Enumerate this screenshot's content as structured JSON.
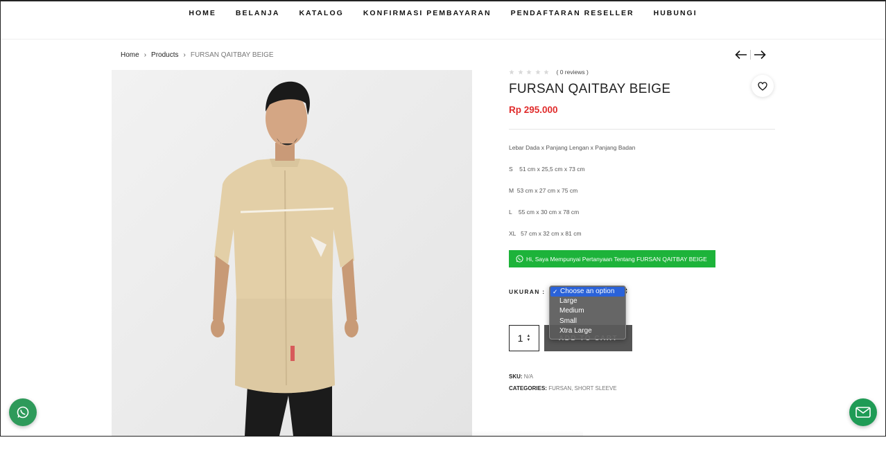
{
  "nav": {
    "items": [
      "HOME",
      "BELANJA",
      "KATALOG",
      "KONFIRMASI PEMBAYARAN",
      "PENDAFTARAN RESELLER",
      "HUBUNGI"
    ]
  },
  "breadcrumb": {
    "home": "Home",
    "products": "Products",
    "current": "FURSAN QAITBAY BEIGE"
  },
  "product": {
    "rating_stars": 0,
    "reviews": "( 0 reviews )",
    "title": "FURSAN QAITBAY BEIGE",
    "price": "Rp 295.000",
    "description": [
      "Lebar Dada x Panjang Lengan x Panjang Badan",
      "S    51 cm x 25,5 cm x 73 cm",
      "M  53 cm x 27 cm x 75 cm",
      "L    55 cm x 30 cm x 78 cm",
      "XL   57 cm x 32 cm x 81 cm"
    ],
    "whatsapp_question": "Hi, Saya Mempunyai Pertanyaan Tentang FURSAN QAITBAY BEIGE",
    "ukuran_label": "UKURAN :",
    "size_options": [
      "Choose an option",
      "Large",
      "Medium",
      "Small",
      "Xtra Large"
    ],
    "selected_option": "Choose an option",
    "quantity": "1",
    "add_to_cart": "ADD TO CART",
    "sku_label": "SKU:",
    "sku_value": "N/A",
    "categories_label": "CATEGORIES:",
    "categories": [
      "FURSAN",
      "SHORT SLEEVE"
    ],
    "category_separator": ", "
  },
  "colors": {
    "price": "#e02b2b",
    "whatsapp_green": "#1db33a",
    "dropdown_highlight": "#2a62d9",
    "float_button": "#2e9a5a"
  },
  "icons": {
    "prev": "arrow-left-icon",
    "next": "arrow-right-icon",
    "wishlist": "heart-icon",
    "whatsapp": "whatsapp-icon",
    "mail": "mail-icon",
    "star": "star-icon"
  }
}
